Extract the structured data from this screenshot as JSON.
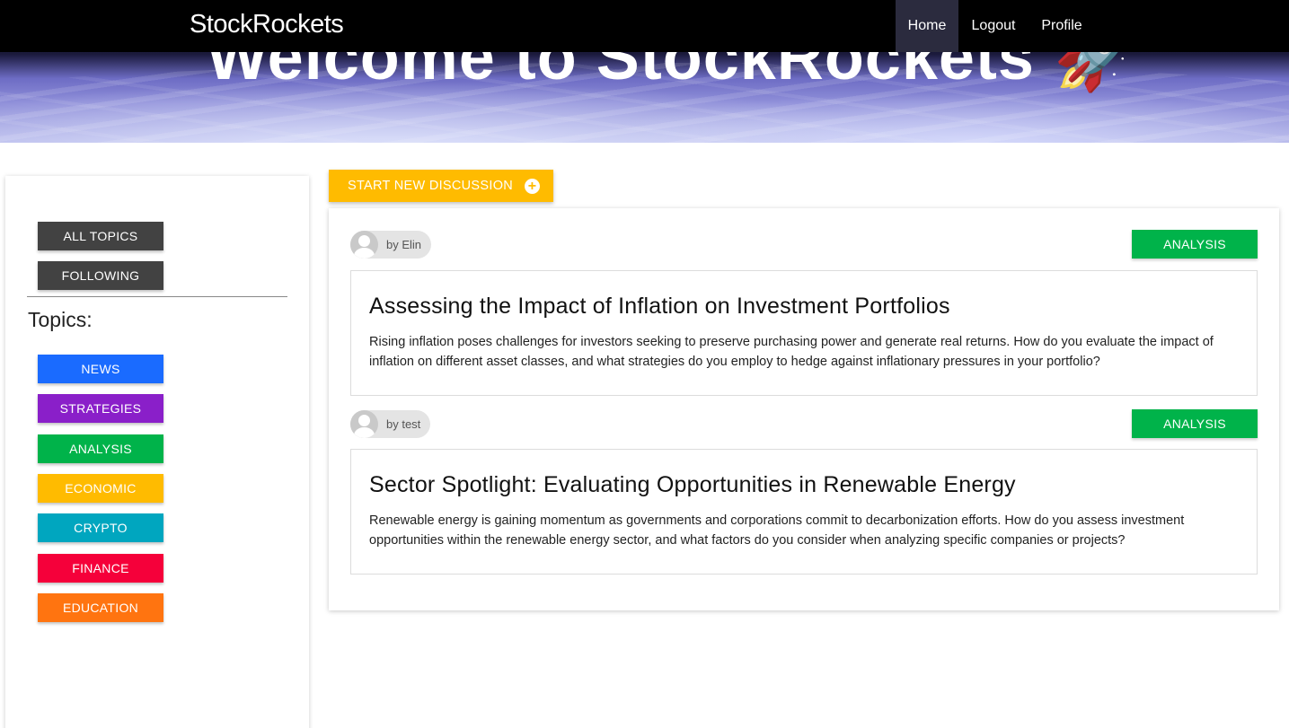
{
  "hero": {
    "title": "Welcome to StockRockets 🚀"
  },
  "navbar": {
    "brand": "StockRockets",
    "items": [
      {
        "label": "Home",
        "active": true
      },
      {
        "label": "Logout"
      },
      {
        "label": "Profile"
      }
    ]
  },
  "sidebar": {
    "filters": [
      {
        "label": "ALL TOPICS"
      },
      {
        "label": "FOLLOWING"
      }
    ],
    "topics_heading": "Topics:",
    "topics": [
      {
        "label": "NEWS",
        "color": "#1a6bff"
      },
      {
        "label": "STRATEGIES",
        "color": "#8a1fc9"
      },
      {
        "label": "ANALYSIS",
        "color": "#00b34a"
      },
      {
        "label": "ECONOMIC",
        "color": "#ffbb00"
      },
      {
        "label": "CRYPTO",
        "color": "#00a6bf"
      },
      {
        "label": "FINANCE",
        "color": "#f5003a"
      },
      {
        "label": "EDUCATION",
        "color": "#ff7410"
      }
    ]
  },
  "start_discussion": {
    "label": "START NEW DISCUSSION",
    "icon": "plus-circle-icon",
    "color": "#ffbb00"
  },
  "posts": [
    {
      "author": "by Elin",
      "category": "ANALYSIS",
      "title": "Assessing the Impact of Inflation on Investment Portfolios",
      "body": "Rising inflation poses challenges for investors seeking to preserve purchasing power and generate real returns. How do you evaluate the impact of inflation on different asset classes, and what strategies do you employ to hedge against inflationary pressures in your portfolio?"
    },
    {
      "author": "by test",
      "category": "ANALYSIS",
      "title": "Sector Spotlight: Evaluating Opportunities in Renewable Energy",
      "body": "Renewable energy is gaining momentum as governments and corporations commit to decarbonization efforts. How do you assess investment opportunities within the renewable energy sector, and what factors do you consider when analyzing specific companies or projects?"
    }
  ]
}
